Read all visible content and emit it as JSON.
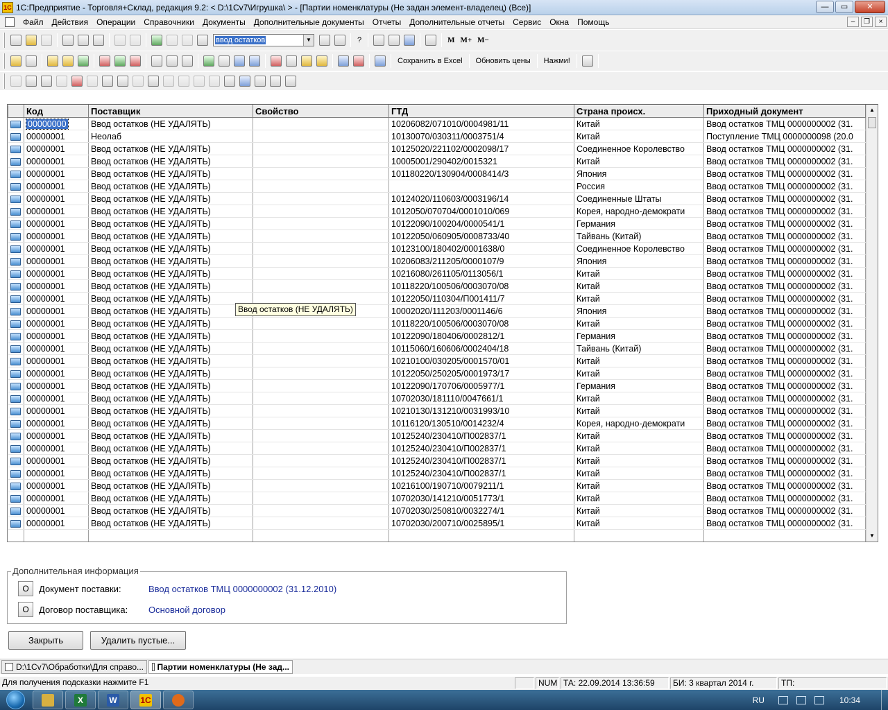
{
  "titlebar": {
    "title": "1С:Предприятие - Торговля+Склад, редакция 9.2:  < D:\\1Cv7\\Игрушка\\ >  - [Партии номенклатуры (Не задан элемент-владелец) (Все)]",
    "min": "—",
    "max": "▭",
    "close": "✕"
  },
  "menu": [
    "Файл",
    "Действия",
    "Операции",
    "Справочники",
    "Документы",
    "Дополнительные документы",
    "Отчеты",
    "Дополнительные отчеты",
    "Сервис",
    "Окна",
    "Помощь"
  ],
  "mdi": {
    "min": "–",
    "restore": "❐",
    "close": "×"
  },
  "toolbar1": {
    "search_value": "ввод остатков",
    "help": "?",
    "m": "M",
    "m_plus": "M+",
    "m_minus": "M−"
  },
  "toolbar2": {
    "excel": "Сохранить в Excel",
    "update_prices": "Обновить цены",
    "press": "Нажми!"
  },
  "table": {
    "columns": [
      "",
      "Код",
      "Поставщик",
      "Свойство",
      "ГТД",
      "Страна происх.",
      "Приходный документ"
    ],
    "rows": [
      [
        "00000000",
        "Ввод остатков (НЕ УДАЛЯТЬ)",
        "",
        "10206082/071010/0004981/11",
        "Китай",
        "Ввод остатков ТМЦ 0000000002 (31."
      ],
      [
        "00000001",
        "Неолаб",
        "",
        "10130070/030311/0003751/4",
        "Китай",
        "Поступление ТМЦ 0000000098 (20.0"
      ],
      [
        "00000001",
        "Ввод остатков (НЕ УДАЛЯТЬ)",
        "",
        "10125020/221102/0002098/17",
        "Соединенное Королевство",
        "Ввод остатков ТМЦ 0000000002 (31."
      ],
      [
        "00000001",
        "Ввод остатков (НЕ УДАЛЯТЬ)",
        "",
        "10005001/290402/0015321",
        "Китай",
        "Ввод остатков ТМЦ 0000000002 (31."
      ],
      [
        "00000001",
        "Ввод остатков (НЕ УДАЛЯТЬ)",
        "",
        "101180220/130904/0008414/3",
        "Япония",
        "Ввод остатков ТМЦ 0000000002 (31."
      ],
      [
        "00000001",
        "Ввод остатков (НЕ УДАЛЯТЬ)",
        "",
        "",
        "Россия",
        "Ввод остатков ТМЦ 0000000002 (31."
      ],
      [
        "00000001",
        "Ввод остатков (НЕ УДАЛЯТЬ)",
        "",
        "10124020/110603/0003196/14",
        "Соединенные Штаты",
        "Ввод остатков ТМЦ 0000000002 (31."
      ],
      [
        "00000001",
        "Ввод остатков (НЕ УДАЛЯТЬ)",
        "",
        "1012050/070704/0001010/069",
        "Корея, народно-демократи",
        "Ввод остатков ТМЦ 0000000002 (31."
      ],
      [
        "00000001",
        "Ввод остатков (НЕ УДАЛЯТЬ)",
        "",
        "10122090/100204/0000541/1",
        "Германия",
        "Ввод остатков ТМЦ 0000000002 (31."
      ],
      [
        "00000001",
        "Ввод остатков (НЕ УДАЛЯТЬ)",
        "",
        "10122050/060905/0008733/40",
        "Тайвань (Китай)",
        "Ввод остатков ТМЦ 0000000002 (31."
      ],
      [
        "00000001",
        "Ввод остатков (НЕ УДАЛЯТЬ)",
        "",
        "10123100/180402/0001638/0",
        "Соединенное Королевство",
        "Ввод остатков ТМЦ 0000000002 (31."
      ],
      [
        "00000001",
        "Ввод остатков (НЕ УДАЛЯТЬ)",
        "",
        "10206083/211205/0000107/9",
        "Япония",
        "Ввод остатков ТМЦ 0000000002 (31."
      ],
      [
        "00000001",
        "Ввод остатков (НЕ УДАЛЯТЬ)",
        "",
        "10216080/261105/0113056/1",
        "Китай",
        "Ввод остатков ТМЦ 0000000002 (31."
      ],
      [
        "00000001",
        "Ввод остатков (НЕ УДАЛЯТЬ)",
        "",
        "10118220/100506/0003070/08",
        "Китай",
        "Ввод остатков ТМЦ 0000000002 (31."
      ],
      [
        "00000001",
        "Ввод остатков (НЕ УДАЛЯТЬ)",
        "",
        "10122050/110304/П001411/7",
        "Китай",
        "Ввод остатков ТМЦ 0000000002 (31."
      ],
      [
        "00000001",
        "Ввод остатков (НЕ УДАЛЯТЬ)",
        "",
        "10002020/111203/0001146/6",
        "Япония",
        "Ввод остатков ТМЦ 0000000002 (31."
      ],
      [
        "00000001",
        "Ввод остатков (НЕ УДАЛЯТЬ)",
        "",
        "10118220/100506/0003070/08",
        "Китай",
        "Ввод остатков ТМЦ 0000000002 (31."
      ],
      [
        "00000001",
        "Ввод остатков (НЕ УДАЛЯТЬ)",
        "",
        "10122090/180406/0002812/1",
        "Германия",
        "Ввод остатков ТМЦ 0000000002 (31."
      ],
      [
        "00000001",
        "Ввод остатков (НЕ УДАЛЯТЬ)",
        "",
        "10115060/160606/0002404/18",
        "Тайвань (Китай)",
        "Ввод остатков ТМЦ 0000000002 (31."
      ],
      [
        "00000001",
        "Ввод остатков (НЕ УДАЛЯТЬ)",
        "",
        "10210100/030205/0001570/01",
        "Китай",
        "Ввод остатков ТМЦ 0000000002 (31."
      ],
      [
        "00000001",
        "Ввод остатков (НЕ УДАЛЯТЬ)",
        "",
        "10122050/250205/0001973/17",
        "Китай",
        "Ввод остатков ТМЦ 0000000002 (31."
      ],
      [
        "00000001",
        "Ввод остатков (НЕ УДАЛЯТЬ)",
        "",
        "10122090/170706/0005977/1",
        "Германия",
        "Ввод остатков ТМЦ 0000000002 (31."
      ],
      [
        "00000001",
        "Ввод остатков (НЕ УДАЛЯТЬ)",
        "",
        "10702030/181110/0047661/1",
        "Китай",
        "Ввод остатков ТМЦ 0000000002 (31."
      ],
      [
        "00000001",
        "Ввод остатков (НЕ УДАЛЯТЬ)",
        "",
        "10210130/131210/0031993/10",
        "Китай",
        "Ввод остатков ТМЦ 0000000002 (31."
      ],
      [
        "00000001",
        "Ввод остатков (НЕ УДАЛЯТЬ)",
        "",
        "10116120/130510/0014232/4",
        "Корея, народно-демократи",
        "Ввод остатков ТМЦ 0000000002 (31."
      ],
      [
        "00000001",
        "Ввод остатков (НЕ УДАЛЯТЬ)",
        "",
        "10125240/230410/П002837/1",
        "Китай",
        "Ввод остатков ТМЦ 0000000002 (31."
      ],
      [
        "00000001",
        "Ввод остатков (НЕ УДАЛЯТЬ)",
        "",
        "10125240/230410/П002837/1",
        "Китай",
        "Ввод остатков ТМЦ 0000000002 (31."
      ],
      [
        "00000001",
        "Ввод остатков (НЕ УДАЛЯТЬ)",
        "",
        "10125240/230410/П002837/1",
        "Китай",
        "Ввод остатков ТМЦ 0000000002 (31."
      ],
      [
        "00000001",
        "Ввод остатков (НЕ УДАЛЯТЬ)",
        "",
        "10125240/230410/П002837/1",
        "Китай",
        "Ввод остатков ТМЦ 0000000002 (31."
      ],
      [
        "00000001",
        "Ввод остатков (НЕ УДАЛЯТЬ)",
        "",
        "10216100/190710/0079211/1",
        "Китай",
        "Ввод остатков ТМЦ 0000000002 (31."
      ],
      [
        "00000001",
        "Ввод остатков (НЕ УДАЛЯТЬ)",
        "",
        "10702030/141210/0051773/1",
        "Китай",
        "Ввод остатков ТМЦ 0000000002 (31."
      ],
      [
        "00000001",
        "Ввод остатков (НЕ УДАЛЯТЬ)",
        "",
        "10702030/250810/0032274/1",
        "Китай",
        "Ввод остатков ТМЦ 0000000002 (31."
      ],
      [
        "00000001",
        "Ввод остатков (НЕ УДАЛЯТЬ)",
        "",
        "10702030/200710/0025895/1",
        "Китай",
        "Ввод остатков ТМЦ 0000000002 (31."
      ]
    ]
  },
  "tooltip": "Ввод остатков (НЕ УДАЛЯТЬ)",
  "addinfo": {
    "legend": "Дополнительная информация",
    "btn": "О",
    "supply_doc_label": "Документ поставки:",
    "supply_doc_value": "Ввод остатков ТМЦ 0000000002 (31.12.2010)",
    "contract_label": "Договор поставщика:",
    "contract_value": "Основной договор"
  },
  "buttons": {
    "close": "Закрыть",
    "delete_empty": "Удалить пустые..."
  },
  "window_tabs": [
    "D:\\1Cv7\\Обработки\\Для справо...",
    "Партии номенклатуры (Не зад..."
  ],
  "status": {
    "hint": "Для получения подсказки нажмите F1",
    "num": "NUM",
    "ta": "ТА: 22.09.2014  13:36:59",
    "bi": "БИ: 3 квартал 2014 г.",
    "tp": "ТП:"
  },
  "taskbar": {
    "lang": "RU",
    "clock": "10:34",
    "apps": [
      "explorer",
      "excel",
      "word",
      "1c",
      "firefox"
    ]
  },
  "colors": {
    "selection": "#3a70c8",
    "link_value": "#1a2c9a",
    "tooltip_bg": "#ffffe1"
  }
}
